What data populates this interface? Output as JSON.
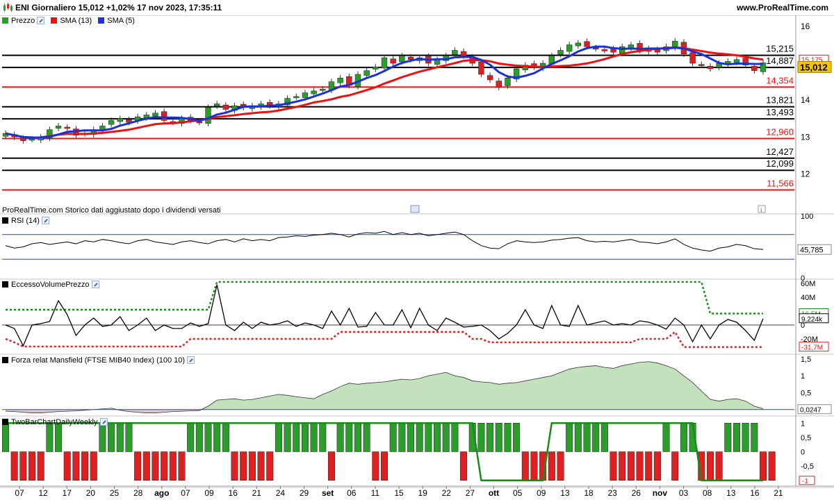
{
  "title": {
    "text": "ENI Giornaliero 15,012 +1,02% 17 nov 2023, 17:35:11",
    "site": "www.ProRealTime.com"
  },
  "note": "ProRealTime.com  Storico dati aggiustato dopo i dividendi versati",
  "colors": {
    "up": "#2a9d2a",
    "down": "#e02020",
    "sma13": "#ee1111",
    "sma5": "#1a32d8",
    "rsi_band": "#3340bb",
    "mansfield_fill": "#b8dcb2",
    "mansfield_neg": "#e4bcb8"
  },
  "legends": {
    "price": "Prezzo",
    "sma13": "SMA (13)",
    "sma5": "SMA (5)",
    "rsi": "RSI (14)",
    "evp": "EccessoVolumePrezzo",
    "mansfield": "Forza relat Mansfield (FTSE MIB40 Index) (100 10)",
    "twobar": "TwoBarChartDailyWeekly"
  },
  "chart_data": [
    {
      "type": "candlestick",
      "name": "Prezzo",
      "ylim": [
        11.2,
        16.3
      ],
      "yticks": [
        12,
        13,
        14,
        15,
        16
      ],
      "closes": [
        13.1,
        13.0,
        12.9,
        12.95,
        13.0,
        13.2,
        13.3,
        13.25,
        13.05,
        13.1,
        13.2,
        13.3,
        13.45,
        13.5,
        13.4,
        13.55,
        13.6,
        13.65,
        13.45,
        13.4,
        13.5,
        13.45,
        13.4,
        13.8,
        13.9,
        13.75,
        13.85,
        13.8,
        13.85,
        13.9,
        13.85,
        13.9,
        14.05,
        14.1,
        14.2,
        14.25,
        14.3,
        14.5,
        14.6,
        14.4,
        14.7,
        14.8,
        14.9,
        15.15,
        15.0,
        15.2,
        15.1,
        15.15,
        15.0,
        15.1,
        15.2,
        15.35,
        15.2,
        15.0,
        14.7,
        14.55,
        14.35,
        14.6,
        14.85,
        14.95,
        14.9,
        15.0,
        15.2,
        15.35,
        15.5,
        15.55,
        15.45,
        15.4,
        15.35,
        15.3,
        15.45,
        15.5,
        15.35,
        15.4,
        15.3,
        15.45,
        15.6,
        15.25,
        15.0,
        14.95,
        14.85,
        15.0,
        15.05,
        15.1,
        14.95,
        14.8,
        15.012
      ],
      "levels": [
        {
          "value": 15.215,
          "label": "15,215",
          "color": "#000000"
        },
        {
          "value": 14.887,
          "label": "14,887",
          "color": "#000000"
        },
        {
          "value": 14.354,
          "label": "14,354",
          "color": "#ee1111"
        },
        {
          "value": 13.821,
          "label": "13,821",
          "color": "#000000"
        },
        {
          "value": 13.493,
          "label": "13,493",
          "color": "#000000"
        },
        {
          "value": 12.96,
          "label": "12,960",
          "color": "#ee1111"
        },
        {
          "value": 12.427,
          "label": "12,427",
          "color": "#000000"
        },
        {
          "value": 12.099,
          "label": "12,099",
          "color": "#000000"
        },
        {
          "value": 11.566,
          "label": "11,566",
          "color": "#ee1111"
        }
      ],
      "last_labels": {
        "sma13": "15,175",
        "sma5": "15,109",
        "price": "15,012"
      }
    },
    {
      "type": "line",
      "name": "RSI (14)",
      "ylim": [
        0,
        100
      ],
      "yticks": [
        {
          "v": 100,
          "l": "100"
        },
        {
          "v": 0,
          "l": "0"
        }
      ],
      "bands": [
        70,
        30
      ],
      "values": [
        52,
        48,
        50,
        55,
        57,
        54,
        56,
        58,
        55,
        60,
        58,
        62,
        60,
        57,
        55,
        60,
        62,
        58,
        56,
        54,
        58,
        60,
        57,
        55,
        60,
        62,
        58,
        63,
        60,
        62,
        60,
        65,
        66,
        68,
        67,
        69,
        70,
        72,
        70,
        66,
        71,
        73,
        72,
        75,
        70,
        73,
        70,
        72,
        68,
        70,
        72,
        74,
        70,
        60,
        52,
        48,
        47,
        55,
        60,
        58,
        57,
        58,
        61,
        62,
        64,
        65,
        60,
        58,
        59,
        58,
        60,
        62,
        58,
        57,
        55,
        58,
        63,
        54,
        48,
        45,
        43,
        48,
        50,
        54,
        52,
        47,
        45.785
      ],
      "last_label": "45,785"
    },
    {
      "type": "line",
      "name": "EccessoVolumePrezzo",
      "ylim": [
        -40,
        65
      ],
      "yticks": [
        {
          "v": 60,
          "l": "60M"
        },
        {
          "v": 40,
          "l": "40M"
        },
        {
          "v": 20,
          "l": "20M"
        },
        {
          "v": 0,
          "l": "0"
        },
        {
          "v": -20,
          "l": "-20M"
        }
      ],
      "values": [
        0,
        -5,
        -30,
        0,
        2,
        5,
        35,
        15,
        -15,
        0,
        10,
        -2,
        0,
        12,
        -8,
        0,
        10,
        -8,
        0,
        -5,
        -5,
        3,
        -2,
        2,
        58,
        0,
        -8,
        4,
        -5,
        4,
        0,
        2,
        6,
        -2,
        3,
        0,
        -5,
        20,
        0,
        24,
        -3,
        -2,
        18,
        0,
        0,
        22,
        -4,
        24,
        0,
        -8,
        10,
        4,
        -3,
        -2,
        0,
        -8,
        -20,
        -12,
        0,
        22,
        0,
        -5,
        28,
        0,
        -2,
        28,
        0,
        3,
        6,
        0,
        2,
        0,
        6,
        4,
        0,
        -6,
        10,
        0,
        -24,
        0,
        -20,
        0,
        8,
        4,
        -8,
        -22,
        9.224
      ],
      "upper_band": [
        22,
        22,
        22,
        22,
        22,
        22,
        22,
        22,
        22,
        22,
        22,
        22,
        22,
        22,
        22,
        22,
        22,
        22,
        22,
        22,
        22,
        22,
        22,
        22,
        62,
        62,
        62,
        62,
        62,
        62,
        62,
        62,
        62,
        62,
        62,
        62,
        62,
        62,
        62,
        62,
        62,
        62,
        62,
        62,
        62,
        62,
        62,
        62,
        62,
        62,
        62,
        62,
        62,
        62,
        62,
        62,
        62,
        62,
        62,
        62,
        62,
        62,
        62,
        62,
        62,
        62,
        62,
        62,
        62,
        62,
        62,
        62,
        62,
        62,
        62,
        62,
        62,
        62,
        62,
        62,
        16.5,
        16.5,
        16.5,
        16.5,
        16.5,
        16.5,
        16.5
      ],
      "lower_band": [
        -20,
        -25,
        -31,
        -31,
        -31,
        -31,
        -31,
        -31,
        -31,
        -31,
        -31,
        -31,
        -31,
        -31,
        -31,
        -31,
        -31,
        -31,
        -31,
        -31,
        -31,
        -20,
        -20,
        -20,
        -20,
        -20,
        -20,
        -20,
        -20,
        -20,
        -20,
        -20,
        -20,
        -20,
        -20,
        -20,
        -20,
        -20,
        -10,
        -10,
        -10,
        -10,
        -10,
        -10,
        -10,
        -10,
        -10,
        -10,
        -10,
        -10,
        -10,
        -10,
        -10,
        -20,
        -20,
        -25,
        -25,
        -25,
        -25,
        -25,
        -25,
        -25,
        -25,
        -25,
        -25,
        -25,
        -25,
        -25,
        -25,
        -25,
        -25,
        -25,
        -20,
        -20,
        -20,
        -20,
        -10,
        -31.7,
        -31.7,
        -31.7,
        -31.7,
        -31.7,
        -31.7,
        -31.7,
        -31.7,
        -31.7,
        -31.7
      ],
      "last_labels": {
        "upper": "16,5M",
        "value": "9,224k",
        "lower": "-31,7M"
      }
    },
    {
      "type": "area",
      "name": "Forza relat Mansfield (FTSE MIB40 Index)",
      "ylim": [
        -0.15,
        1.6
      ],
      "yticks": [
        {
          "v": 1.5,
          "l": "1,5"
        },
        {
          "v": 1,
          "l": "1"
        },
        {
          "v": 0.5,
          "l": "0,5"
        },
        {
          "v": 0,
          "l": "0"
        }
      ],
      "values": [
        -0.05,
        -0.06,
        -0.08,
        -0.1,
        -0.1,
        -0.08,
        -0.06,
        -0.05,
        -0.04,
        -0.02,
        0,
        0.02,
        0.04,
        -0.02,
        -0.06,
        -0.08,
        -0.1,
        -0.1,
        -0.08,
        -0.06,
        -0.05,
        -0.04,
        -0.03,
        0.1,
        0.28,
        0.3,
        0.32,
        0.28,
        0.3,
        0.35,
        0.4,
        0.45,
        0.42,
        0.38,
        0.35,
        0.32,
        0.45,
        0.55,
        0.68,
        0.78,
        0.75,
        0.78,
        0.8,
        0.82,
        0.86,
        0.9,
        0.88,
        0.92,
        1.0,
        1.05,
        1.1,
        1.0,
        0.95,
        0.85,
        0.82,
        0.8,
        0.75,
        0.78,
        0.8,
        0.85,
        0.9,
        0.95,
        1.0,
        1.1,
        1.2,
        1.25,
        1.28,
        1.3,
        1.25,
        1.22,
        1.3,
        1.35,
        1.4,
        1.42,
        1.38,
        1.3,
        1.2,
        1.0,
        0.8,
        0.55,
        0.3,
        0.25,
        0.3,
        0.32,
        0.25,
        0.1,
        0.0247
      ],
      "last_label": "0,0247"
    },
    {
      "type": "bar",
      "name": "TwoBarChartDailyWeekly",
      "ylim": [
        -1.2,
        1.2
      ],
      "yticks": [
        {
          "v": 1,
          "l": "1"
        },
        {
          "v": 0.5,
          "l": "0,5"
        },
        {
          "v": 0,
          "l": "0"
        },
        {
          "v": -0.5,
          "l": "-0,5"
        }
      ],
      "values": [
        1,
        -1,
        -1,
        -1,
        -1,
        1,
        1,
        -1,
        -1,
        -1,
        -1,
        1,
        1,
        1,
        1,
        -1,
        -1,
        -1,
        -1,
        -1,
        -1,
        1,
        1,
        1,
        1,
        1,
        -1,
        -1,
        -1,
        -1,
        -1,
        1,
        1,
        1,
        1,
        1,
        1,
        -1,
        1,
        1,
        1,
        1,
        -1,
        -1,
        1,
        1,
        1,
        1,
        1,
        1,
        1,
        1,
        -1,
        1,
        1,
        1,
        1,
        1,
        1,
        -1,
        -1,
        -1,
        -1,
        -1,
        1,
        1,
        1,
        1,
        1,
        -1,
        -1,
        -1,
        -1,
        -1,
        -1,
        1,
        -1,
        1,
        1,
        -1,
        -1,
        -1,
        1,
        1,
        1,
        1,
        -1,
        -1
      ],
      "weekly": [
        1,
        1,
        1,
        1,
        1,
        1,
        1,
        1,
        1,
        1,
        1,
        1,
        1,
        1,
        1,
        1,
        1,
        1,
        1,
        1,
        1,
        1,
        1,
        1,
        1,
        1,
        1,
        1,
        1,
        1,
        1,
        1,
        1,
        1,
        1,
        1,
        1,
        1,
        1,
        1,
        1,
        1,
        1,
        1,
        1,
        1,
        1,
        1,
        1,
        1,
        1,
        1,
        1,
        1,
        -1,
        -1,
        -1,
        -1,
        -1,
        -1,
        -1,
        -1,
        1,
        1,
        1,
        1,
        1,
        1,
        1,
        1,
        1,
        1,
        1,
        1,
        1,
        1,
        1,
        1,
        1,
        -1,
        -1,
        -1,
        -1,
        -1,
        -1,
        -1,
        -1
      ],
      "last_label": "-1"
    }
  ],
  "x_axis": {
    "labels": [
      "07",
      "12",
      "17",
      "20",
      "25",
      "28",
      "ago",
      "07",
      "09",
      "16",
      "21",
      "24",
      "29",
      "set",
      "06",
      "11",
      "15",
      "19",
      "22",
      "27",
      "ott",
      "05",
      "09",
      "13",
      "18",
      "23",
      "26",
      "nov",
      "03",
      "08",
      "13",
      "16",
      "21"
    ],
    "bold": [
      "ago",
      "set",
      "ott",
      "nov"
    ]
  }
}
